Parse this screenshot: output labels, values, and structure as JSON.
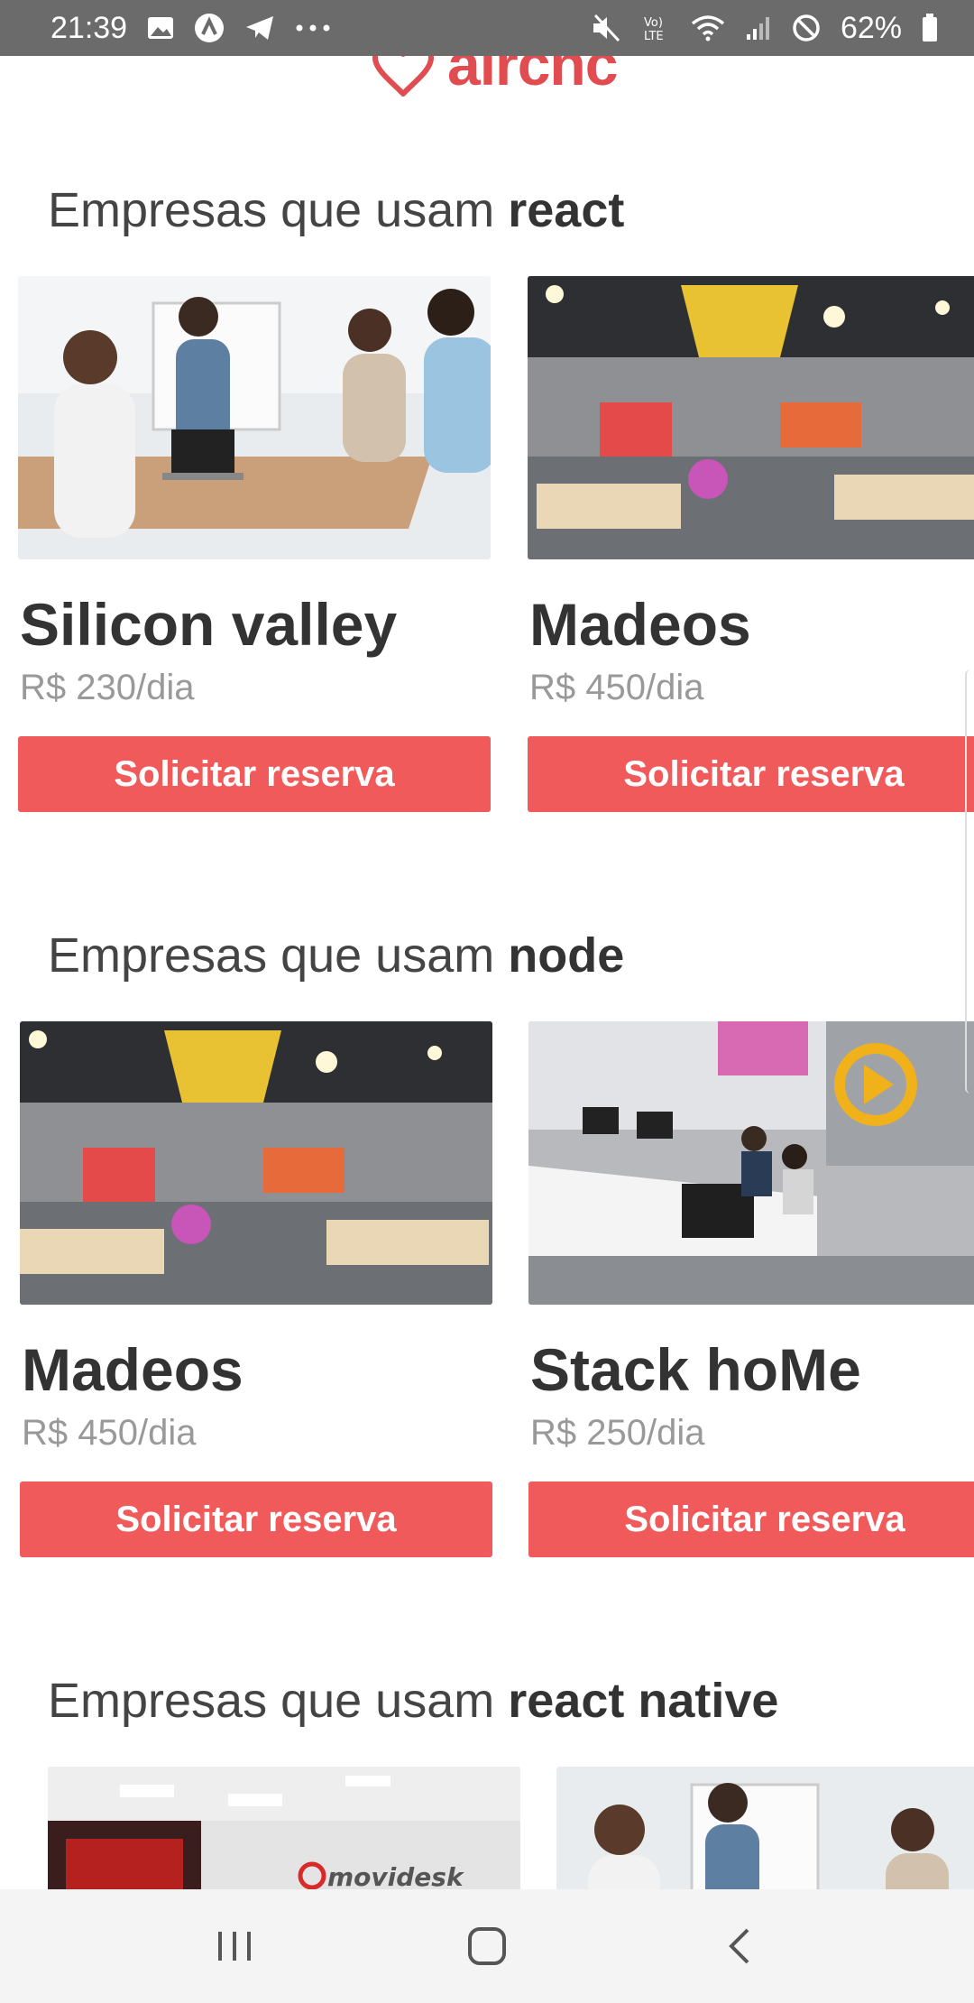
{
  "status_bar": {
    "time": "21:39",
    "battery": "62%",
    "icons": [
      "gallery-icon",
      "app-icon",
      "telegram-icon",
      "more-dots-icon",
      "mute-icon",
      "volte-icon",
      "wifi-icon",
      "signal-icon",
      "dnd-icon",
      "battery-icon"
    ]
  },
  "header": {
    "logo_text": "aircnc",
    "brand_color": "#e14c50"
  },
  "sections": [
    {
      "title_prefix": "Empresas que usam ",
      "tech": "react",
      "cards": [
        {
          "title": "Silicon valley",
          "price": "R$ 230/dia",
          "button": "Solicitar reserva",
          "image": "meeting-photo"
        },
        {
          "title": "Madeos",
          "price": "R$ 450/dia",
          "button": "Solicitar reserva",
          "image": "office-brand-photo"
        }
      ]
    },
    {
      "title_prefix": "Empresas que usam ",
      "tech": "node",
      "cards": [
        {
          "title": "Madeos",
          "price": "R$ 450/dia",
          "button": "Solicitar reserva",
          "image": "office-brand-photo"
        },
        {
          "title": "Stack hoMe",
          "price": "R$ 250/dia",
          "button": "Solicitar reserva",
          "image": "open-office-photo"
        }
      ]
    },
    {
      "title_prefix": "Empresas que usam ",
      "tech": "react native",
      "cards": [
        {
          "image": "movidesk-office-photo",
          "image_text": "movidesk"
        },
        {
          "image": "meeting-photo"
        }
      ]
    }
  ],
  "colors": {
    "button": "#f05a5b",
    "price": "#999999",
    "title": "#333333"
  },
  "nav_bar": {
    "icons": [
      "recent-apps-icon",
      "home-icon",
      "back-icon"
    ]
  }
}
